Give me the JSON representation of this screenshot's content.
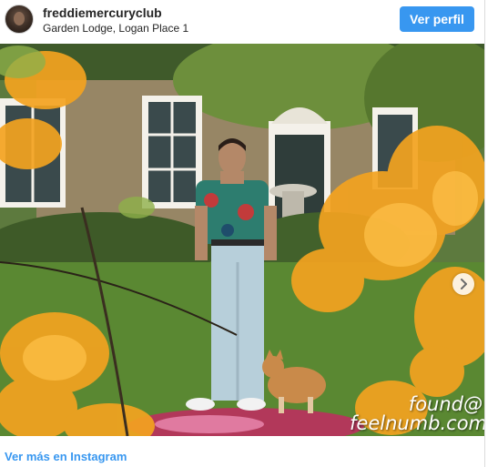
{
  "post": {
    "username": "freddiemercuryclub",
    "location": "Garden Lodge, Logan Place 1",
    "view_profile_label": "Ver perfil",
    "see_more_label": "Ver más en Instagram",
    "image_watermark": [
      "found@",
      "feelnumb.com"
    ]
  },
  "carousel": {
    "next_icon": "chevron-right-icon"
  },
  "colors": {
    "accent": "#3897f0",
    "text": "#262626",
    "border": "#dbdbdb"
  }
}
